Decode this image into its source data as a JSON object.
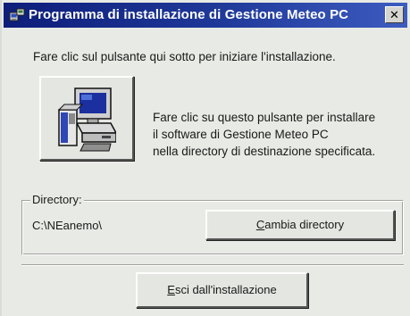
{
  "window": {
    "title": "Programma di installazione di Gestione Meteo PC",
    "close_glyph": "✕"
  },
  "intro_text": "Fare clic sul pulsante qui sotto per iniziare l'installazione.",
  "install": {
    "icon": "computer-setup-icon",
    "description_lines": [
      "Fare clic su questo pulsante per installare",
      "il software di Gestione Meteo PC",
      "nella directory di destinazione specificata."
    ]
  },
  "directory": {
    "group_label": "Directory:",
    "path": "C:\\NEanemo\\",
    "change_button_first": "C",
    "change_button_rest": "ambia directory"
  },
  "exit_button": {
    "first": "E",
    "rest": "sci dall'installazione"
  }
}
